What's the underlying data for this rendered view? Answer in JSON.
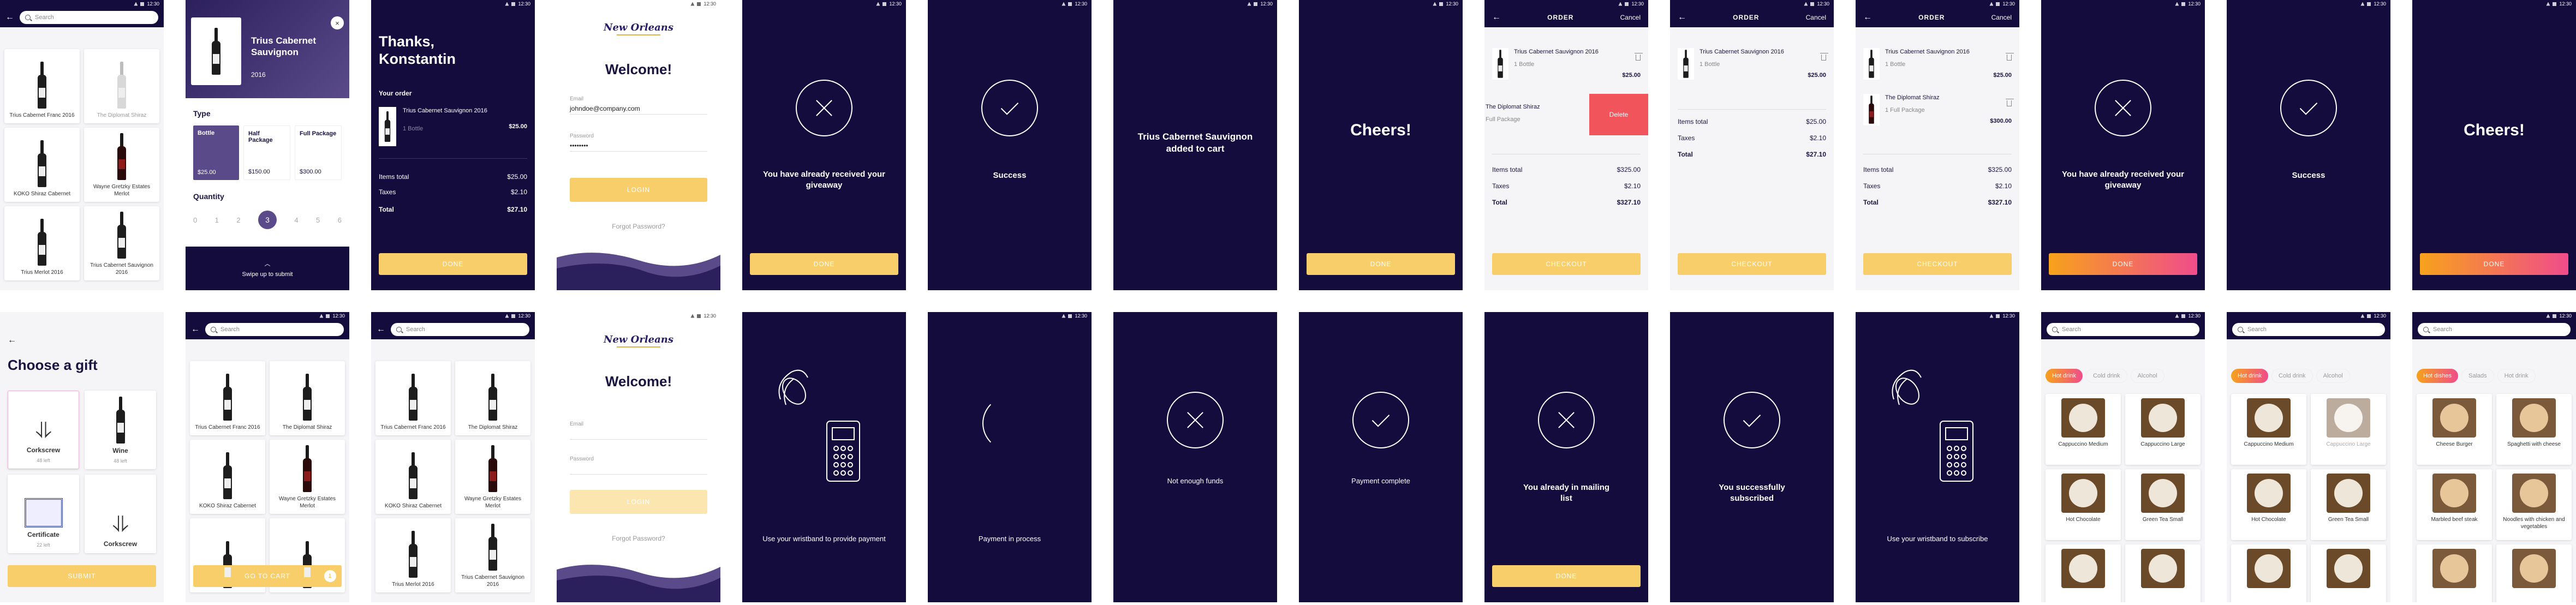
{
  "status_time": "12:30",
  "wines": {
    "search_placeholder": "Search",
    "items": [
      "Trius Cabernet Franc 2016",
      "The Diplomat Shiraz",
      "KOKO Shiraz Cabernet",
      "Wayne Gretzky Estates Merlot",
      "Trius Merlot 2016",
      "Trius Cabernet Sauvignon 2016"
    ]
  },
  "detail": {
    "name": "Trius Cabernet Sauvignon",
    "year": "2016",
    "type_label": "Type",
    "types": [
      {
        "name": "Bottle",
        "price": "$25.00"
      },
      {
        "name": "Half Package",
        "price": "$150.00"
      },
      {
        "name": "Full Package",
        "price": "$300.00"
      }
    ],
    "quantity_label": "Quantity",
    "quantities": [
      "0",
      "1",
      "2",
      "3",
      "4",
      "5",
      "6"
    ],
    "selected_quantity": "3",
    "swipe_label": "Swipe up to submit"
  },
  "thanks": {
    "title": "Thanks, Konstantin",
    "order_label": "Your order",
    "item_name": "Trius Cabernet Sauvignon 2016",
    "item_qty": "1 Bottle",
    "item_price": "$25.00",
    "items_total_label": "Items total",
    "items_total": "$25.00",
    "taxes_label": "Taxes",
    "taxes": "$2.10",
    "total_label": "Total",
    "total": "$27.10",
    "done": "DONE"
  },
  "login": {
    "logo": "New Orleans",
    "welcome": "Welcome!",
    "email_label": "Email",
    "email_value": "johndoe@company.com",
    "password_label": "Password",
    "password_value": "••••••••",
    "login_btn": "LOGIN",
    "forgot": "Forgot Password?"
  },
  "messages": {
    "giveaway": "You have already received your giveaway",
    "success": "Success",
    "added": "Trius Cabernet Sauvignon added to cart",
    "cheers": "Cheers!",
    "done": "DONE",
    "not_enough": "Not enough funds",
    "payment_complete": "Payment complete",
    "mailing": "You already in mailing list",
    "subscribed": "You successfully subscribed",
    "wristband_pay": "Use your wristband to provide payment",
    "in_process": "Payment in process",
    "wristband_sub": "Use your wristband to subscribe"
  },
  "order": {
    "title": "ORDER",
    "cancel": "Cancel",
    "item1": "Trius Cabernet Sauvignon 2016",
    "item1_qty": "1 Bottle",
    "item1_price": "$25.00",
    "item2": "The Diplomat Shiraz",
    "item2_qty": "Full Package",
    "item2_qty_b": "1 Full Package",
    "item2_price": "$300.00",
    "delete": "Delete",
    "items_total_label": "Items total",
    "items_total_a": "$325.00",
    "items_total_b": "$25.00",
    "taxes_label": "Taxes",
    "taxes": "$2.10",
    "total_label": "Total",
    "total_a": "$327.10",
    "total_b": "$27.10",
    "checkout": "CHECKOUT"
  },
  "gift": {
    "title": "Choose a gift",
    "items": [
      {
        "name": "Corkscrew",
        "left": "48 left"
      },
      {
        "name": "Wine",
        "left": "48 left"
      },
      {
        "name": "Certificate",
        "left": "22 left"
      },
      {
        "name": "Corkscrew",
        "left": ""
      }
    ],
    "submit": "SUBMIT"
  },
  "cart_btn": "GO TO CART",
  "cart_count": "1",
  "drinks": {
    "chips": [
      "Hot drink",
      "Cold drink",
      "Alcohol"
    ],
    "items": [
      "Cappuccino Medium",
      "Cappuccino Large",
      "Hot Chocolate",
      "Green Tea Small"
    ]
  },
  "dishes": {
    "chips": [
      "Hot dishes",
      "Salads",
      "Hot drink"
    ],
    "items": [
      "Cheese Burger",
      "Spaghetti with cheese",
      "Marbled beef steak",
      "Noodles with chicken and vegetables"
    ]
  },
  "colors": {
    "navy": "#140c3c",
    "yellow": "#f7ce6a",
    "purple": "#5a4a8a",
    "delete": "#f2545b"
  }
}
